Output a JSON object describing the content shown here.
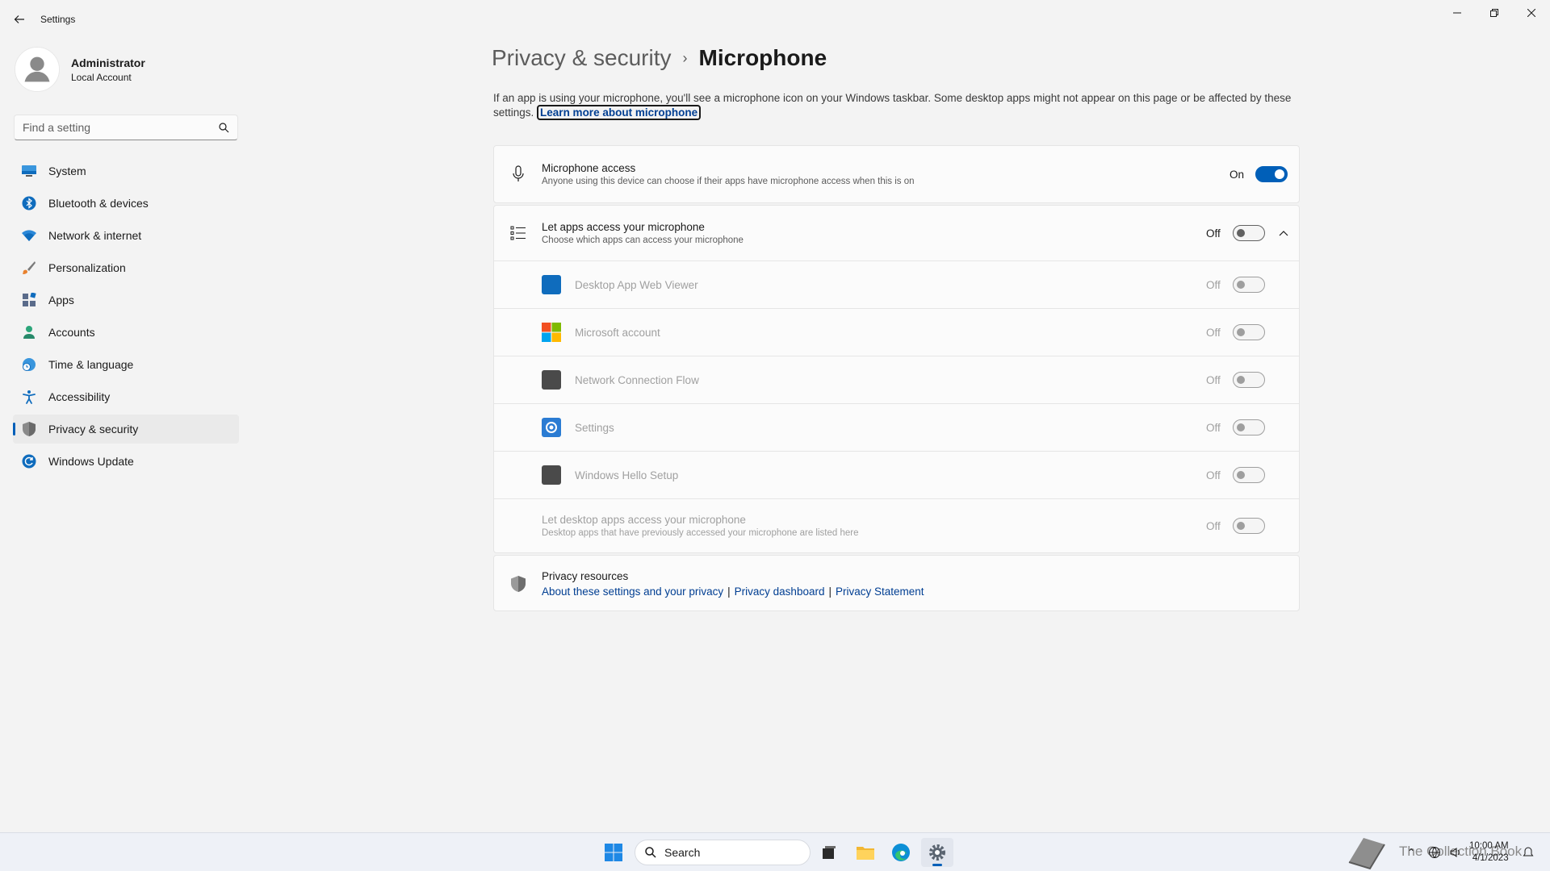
{
  "window": {
    "app_title": "Settings"
  },
  "profile": {
    "name": "Administrator",
    "account_type": "Local Account"
  },
  "search": {
    "placeholder": "Find a setting"
  },
  "nav": {
    "items": [
      {
        "label": "System",
        "icon": "monitor-icon"
      },
      {
        "label": "Bluetooth & devices",
        "icon": "bluetooth-icon"
      },
      {
        "label": "Network & internet",
        "icon": "wifi-icon"
      },
      {
        "label": "Personalization",
        "icon": "brush-icon"
      },
      {
        "label": "Apps",
        "icon": "apps-icon"
      },
      {
        "label": "Accounts",
        "icon": "person-icon"
      },
      {
        "label": "Time & language",
        "icon": "globe-clock-icon"
      },
      {
        "label": "Accessibility",
        "icon": "accessibility-icon"
      },
      {
        "label": "Privacy & security",
        "icon": "shield-icon",
        "active": true
      },
      {
        "label": "Windows Update",
        "icon": "update-icon"
      }
    ]
  },
  "page": {
    "breadcrumb_parent": "Privacy & security",
    "breadcrumb_sep": "›",
    "title": "Microphone",
    "description": "If an app is using your microphone, you'll see a microphone icon on your Windows taskbar. Some desktop apps might not appear on this page or be affected by these settings.",
    "learn_more": "Learn more about microphone"
  },
  "microphone_access": {
    "title": "Microphone access",
    "subtitle": "Anyone using this device can choose if their apps have microphone access when this is on",
    "state": "On"
  },
  "let_apps": {
    "title": "Let apps access your microphone",
    "subtitle": "Choose which apps can access your microphone",
    "state": "Off"
  },
  "apps": [
    {
      "name": "Desktop App Web Viewer",
      "state": "Off",
      "color": "#0f6cbd"
    },
    {
      "name": "Microsoft account",
      "state": "Off",
      "color": "#f25022"
    },
    {
      "name": "Network Connection Flow",
      "state": "Off",
      "color": "#4a4a4a"
    },
    {
      "name": "Settings",
      "state": "Off",
      "color": "#2b7cd3"
    },
    {
      "name": "Windows Hello Setup",
      "state": "Off",
      "color": "#4a4a4a"
    }
  ],
  "desktop_apps": {
    "title": "Let desktop apps access your microphone",
    "subtitle": "Desktop apps that have previously accessed your microphone are listed here",
    "state": "Off"
  },
  "privacy_resources": {
    "title": "Privacy resources",
    "link1": "About these settings and your privacy",
    "link2": "Privacy dashboard",
    "link3": "Privacy Statement",
    "separator": "|"
  },
  "taskbar": {
    "search_label": "Search",
    "time": "10:00 AM",
    "date": "4/1/2023",
    "watermark": "The Collection Book"
  },
  "colors": {
    "accent": "#005fb8",
    "link": "#003e92"
  }
}
